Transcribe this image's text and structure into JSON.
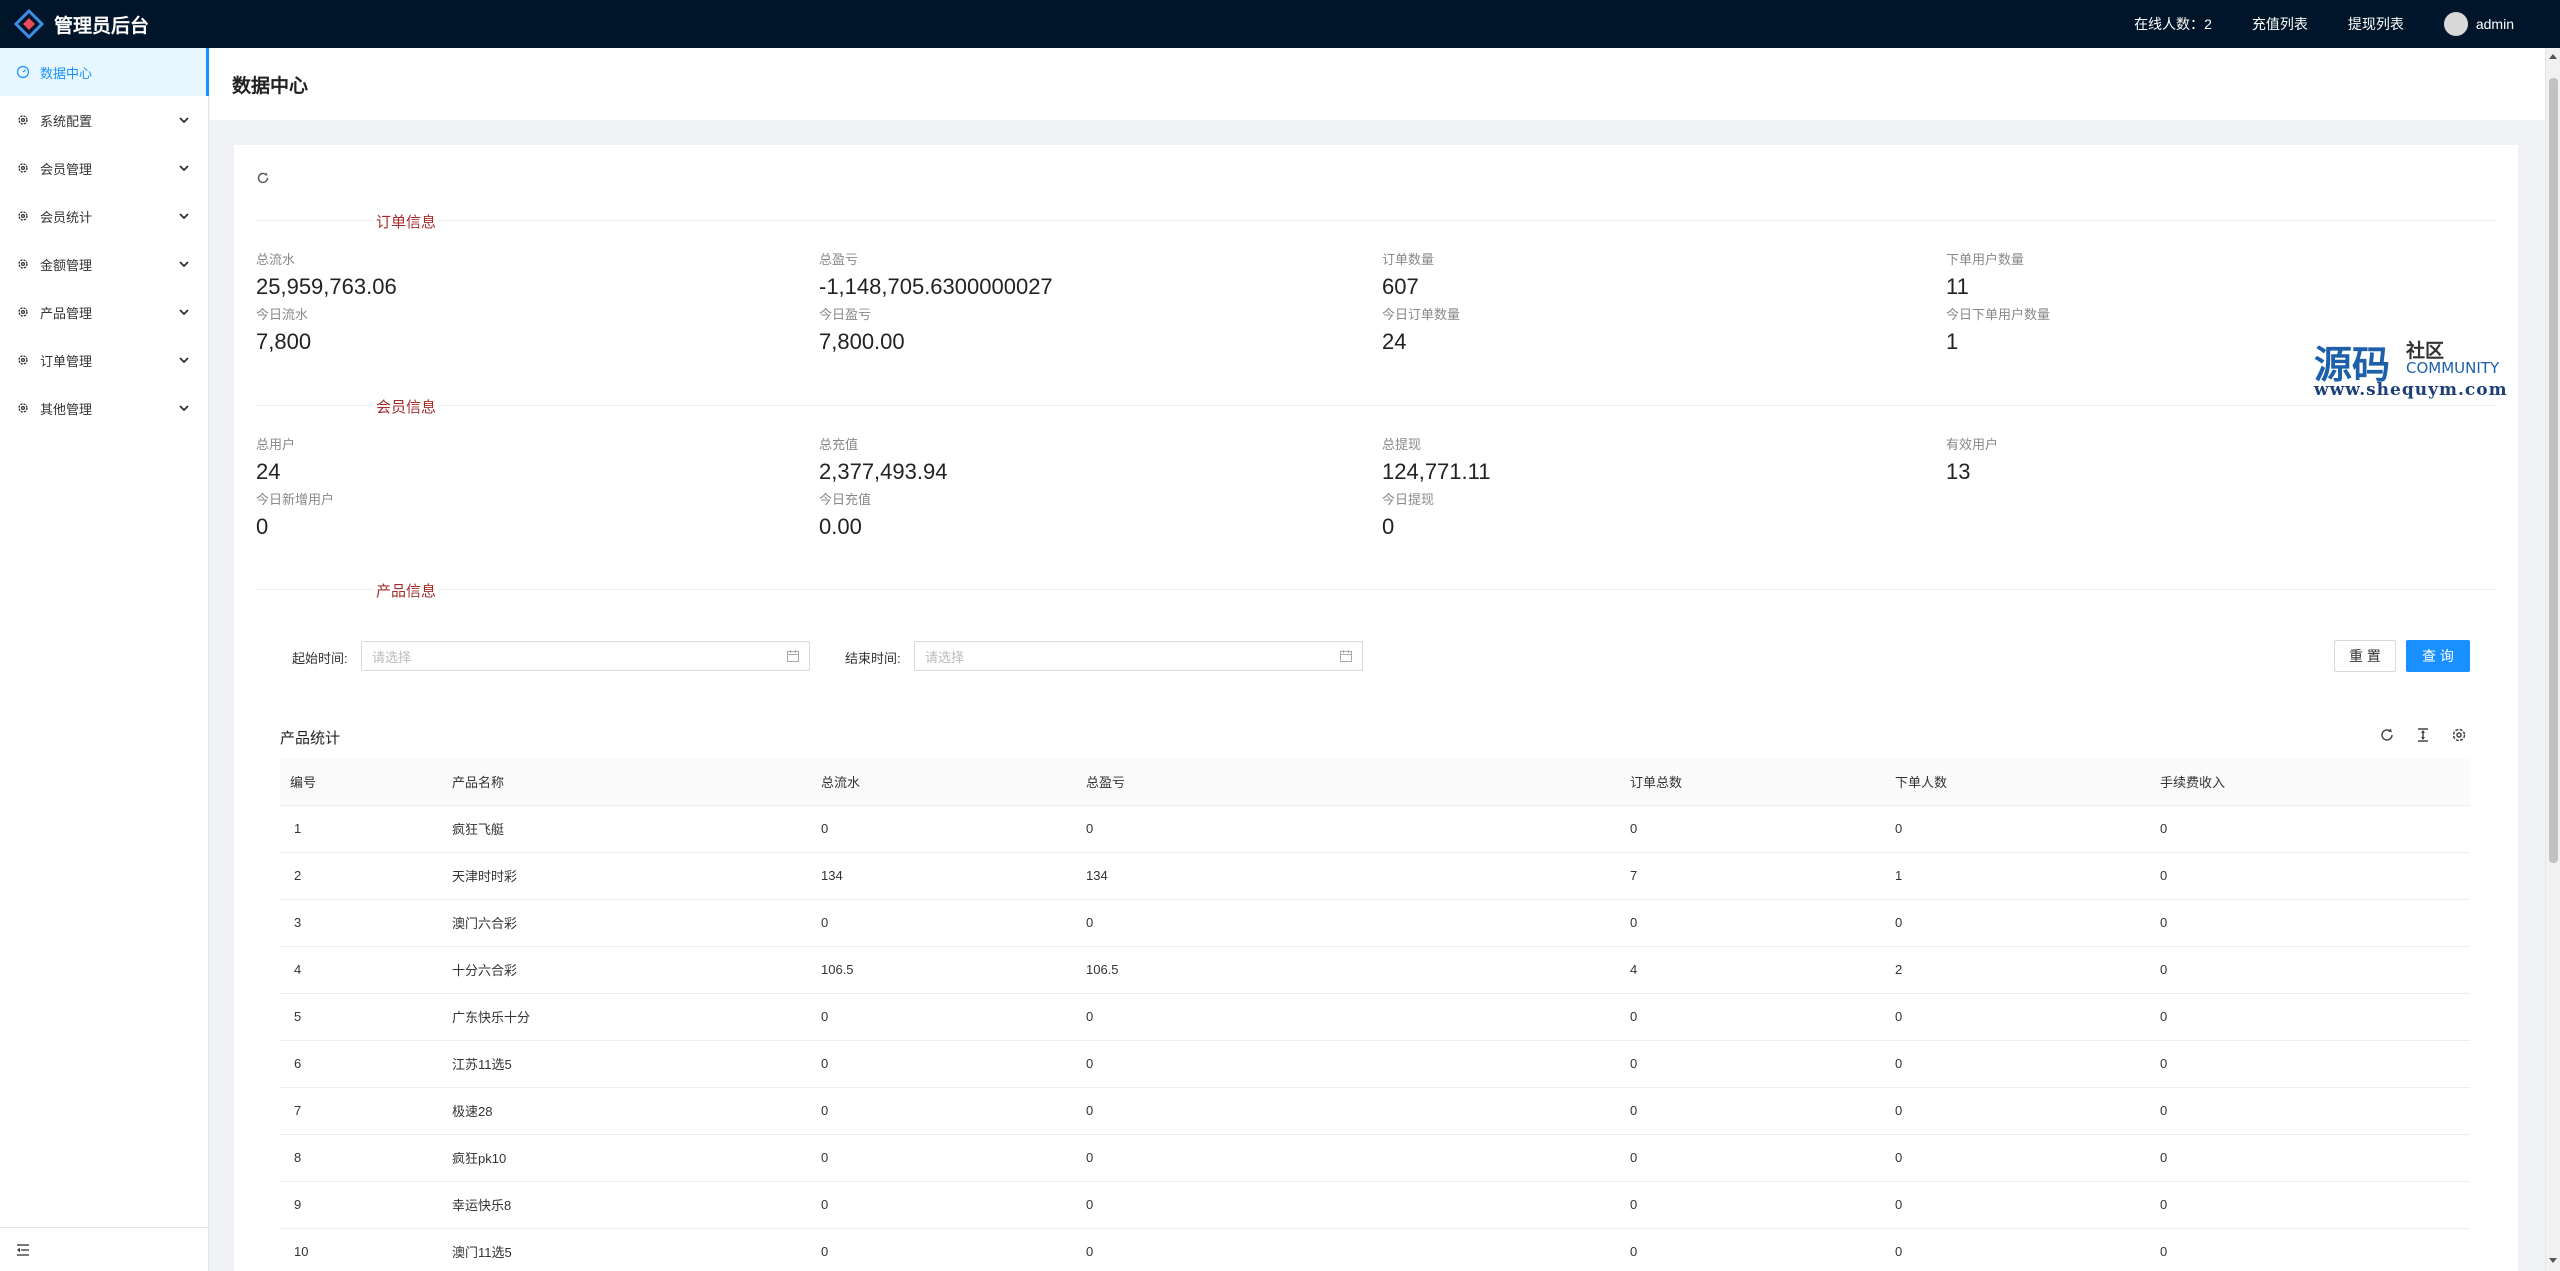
{
  "header": {
    "title": "管理员后台",
    "online_label": "在线人数：",
    "online_count": "2",
    "recharge_link": "充值列表",
    "withdraw_link": "提现列表",
    "user": "admin"
  },
  "sidebar": {
    "items": [
      {
        "label": "数据中心",
        "icon": "dashboard-icon",
        "active": true
      },
      {
        "label": "系统配置",
        "icon": "settings-icon"
      },
      {
        "label": "会员管理",
        "icon": "settings-icon"
      },
      {
        "label": "会员统计",
        "icon": "settings-icon"
      },
      {
        "label": "金额管理",
        "icon": "settings-icon"
      },
      {
        "label": "产品管理",
        "icon": "settings-icon"
      },
      {
        "label": "订单管理",
        "icon": "settings-icon"
      },
      {
        "label": "其他管理",
        "icon": "settings-icon"
      }
    ]
  },
  "page": {
    "title": "数据中心"
  },
  "sections": {
    "order": "订单信息",
    "member": "会员信息",
    "product": "产品信息"
  },
  "order_stats": [
    {
      "label": "总流水",
      "value": "25,959,763.06",
      "sub_label": "今日流水",
      "sub_value": "7,800"
    },
    {
      "label": "总盈亏",
      "value": "-1,148,705.6300000027",
      "sub_label": "今日盈亏",
      "sub_value": "7,800.00"
    },
    {
      "label": "订单数量",
      "value": "607",
      "sub_label": "今日订单数量",
      "sub_value": "24"
    },
    {
      "label": "下单用户数量",
      "value": "11",
      "sub_label": "今日下单用户数量",
      "sub_value": "1"
    }
  ],
  "member_stats": [
    {
      "label": "总用户",
      "value": "24",
      "sub_label": "今日新增用户",
      "sub_value": "0"
    },
    {
      "label": "总充值",
      "value": "2,377,493.94",
      "sub_label": "今日充值",
      "sub_value": "0.00"
    },
    {
      "label": "总提现",
      "value": "124,771.11",
      "sub_label": "今日提现",
      "sub_value": "0"
    },
    {
      "label": "有效用户",
      "value": "13"
    }
  ],
  "watermark": {
    "big": "源码",
    "sq": "社区",
    "community": "COMMUNITY",
    "url": "www.shequym.com"
  },
  "filter": {
    "start_label": "起始时间:",
    "end_label": "结束时间:",
    "placeholder": "请选择",
    "reset": "重 置",
    "query": "查 询"
  },
  "table": {
    "title": "产品统计",
    "columns": [
      "编号",
      "产品名称",
      "总流水",
      "总盈亏",
      "订单总数",
      "下单人数",
      "手续费收入"
    ],
    "rows": [
      [
        "1",
        "疯狂飞艇",
        "0",
        "0",
        "0",
        "0",
        "0"
      ],
      [
        "2",
        "天津时时彩",
        "134",
        "134",
        "7",
        "1",
        "0"
      ],
      [
        "3",
        "澳门六合彩",
        "0",
        "0",
        "0",
        "0",
        "0"
      ],
      [
        "4",
        "十分六合彩",
        "106.5",
        "106.5",
        "4",
        "2",
        "0"
      ],
      [
        "5",
        "广东快乐十分",
        "0",
        "0",
        "0",
        "0",
        "0"
      ],
      [
        "6",
        "江苏11选5",
        "0",
        "0",
        "0",
        "0",
        "0"
      ],
      [
        "7",
        "极速28",
        "0",
        "0",
        "0",
        "0",
        "0"
      ],
      [
        "8",
        "疯狂pk10",
        "0",
        "0",
        "0",
        "0",
        "0"
      ],
      [
        "9",
        "幸运快乐8",
        "0",
        "0",
        "0",
        "0",
        "0"
      ],
      [
        "10",
        "澳门11选5",
        "0",
        "0",
        "0",
        "0",
        "0"
      ]
    ]
  }
}
